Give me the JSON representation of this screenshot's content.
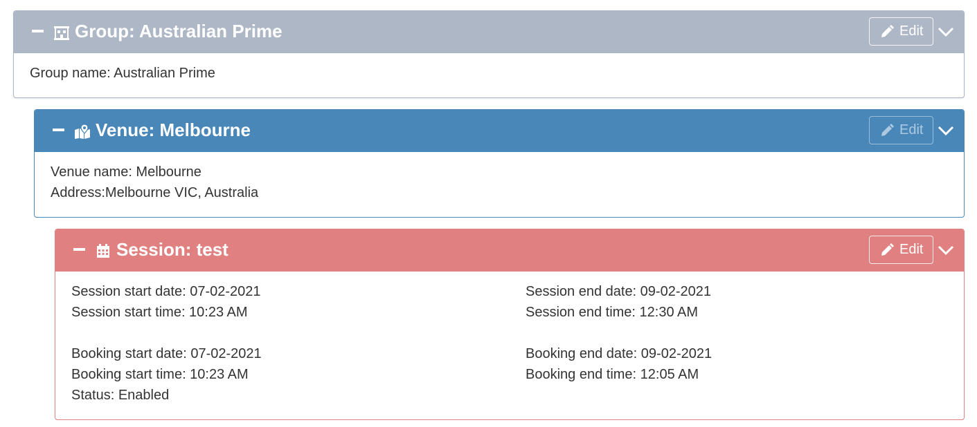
{
  "group": {
    "title": "Group: Australian Prime",
    "edit_label": "Edit",
    "icon": "building-icon",
    "accent_color": "#aeb7c6",
    "fields": [
      {
        "text": "Group name: Australian Prime"
      }
    ]
  },
  "venue": {
    "title": "Venue: Melbourne",
    "edit_label": "Edit",
    "icon": "map-marker-icon",
    "accent_color": "#4a87b9",
    "fields": [
      {
        "text": "Venue name: Melbourne"
      },
      {
        "text": "Address:Melbourne VIC, Australia"
      }
    ]
  },
  "session": {
    "title": "Session: test",
    "edit_label": "Edit",
    "icon": "calendar-icon",
    "accent_color": "#e08080",
    "left": {
      "session_start_date": "Session start date: 07-02-2021",
      "session_start_time": "Session start time: 10:23 AM",
      "booking_start_date": "Booking start date: 07-02-2021",
      "booking_start_time": "Booking start time: 10:23 AM",
      "status": "Status: Enabled"
    },
    "right": {
      "session_end_date": "Session end date: 09-02-2021",
      "session_end_time": "Session end time: 12:30 AM",
      "booking_end_date": "Booking end date: 09-02-2021",
      "booking_end_time": "Booking end time: 12:05 AM"
    }
  }
}
